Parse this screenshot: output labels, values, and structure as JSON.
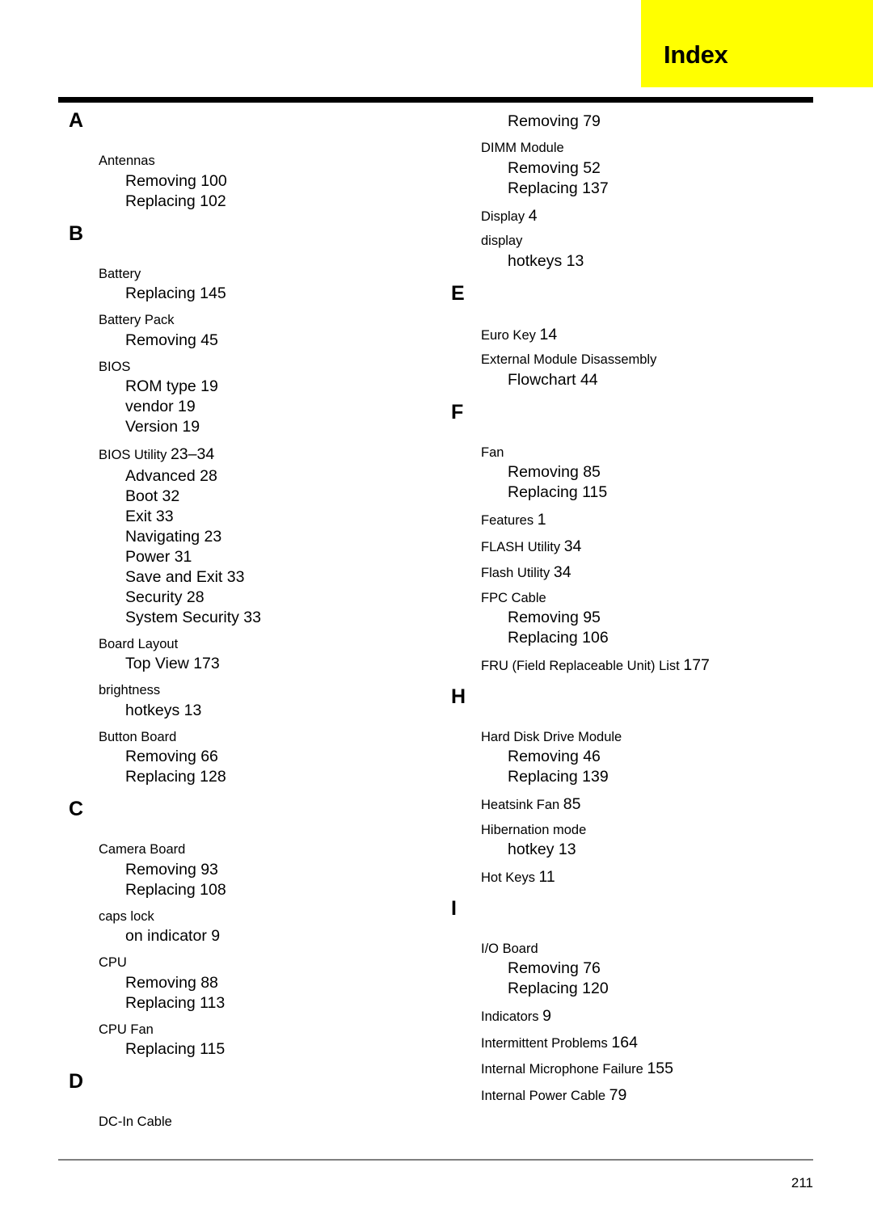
{
  "header": {
    "title": "Index"
  },
  "footer": {
    "page_number": "211"
  },
  "columns": {
    "left": [
      {
        "type": "letter",
        "text": "A"
      },
      {
        "type": "entry",
        "text": "Antennas",
        "page": ""
      },
      {
        "type": "sub",
        "text": "Removing 100"
      },
      {
        "type": "sub",
        "text": "Replacing 102"
      },
      {
        "type": "letter",
        "text": "B"
      },
      {
        "type": "entry",
        "text": "Battery",
        "page": ""
      },
      {
        "type": "sub",
        "text": "Replacing 145"
      },
      {
        "type": "entry",
        "text": "Battery Pack",
        "page": ""
      },
      {
        "type": "sub",
        "text": "Removing 45"
      },
      {
        "type": "entry",
        "text": "BIOS",
        "page": ""
      },
      {
        "type": "sub",
        "text": "ROM type 19"
      },
      {
        "type": "sub",
        "text": "vendor 19"
      },
      {
        "type": "sub",
        "text": "Version 19"
      },
      {
        "type": "entry",
        "text": "BIOS Utility ",
        "page": "23–34"
      },
      {
        "type": "sub",
        "text": "Advanced 28"
      },
      {
        "type": "sub",
        "text": "Boot 32"
      },
      {
        "type": "sub",
        "text": "Exit 33"
      },
      {
        "type": "sub",
        "text": "Navigating 23"
      },
      {
        "type": "sub",
        "text": "Power 31"
      },
      {
        "type": "sub",
        "text": "Save and Exit 33"
      },
      {
        "type": "sub",
        "text": "Security 28"
      },
      {
        "type": "sub",
        "text": "System Security 33"
      },
      {
        "type": "entry",
        "text": "Board Layout",
        "page": ""
      },
      {
        "type": "sub",
        "text": "Top View 173"
      },
      {
        "type": "entry",
        "text": "brightness",
        "page": ""
      },
      {
        "type": "sub",
        "text": "hotkeys 13"
      },
      {
        "type": "entry",
        "text": "Button Board",
        "page": ""
      },
      {
        "type": "sub",
        "text": "Removing 66"
      },
      {
        "type": "sub",
        "text": "Replacing 128"
      },
      {
        "type": "letter",
        "text": "C"
      },
      {
        "type": "entry",
        "text": "Camera Board",
        "page": ""
      },
      {
        "type": "sub",
        "text": "Removing 93"
      },
      {
        "type": "sub",
        "text": "Replacing 108"
      },
      {
        "type": "entry",
        "text": "caps lock",
        "page": ""
      },
      {
        "type": "sub",
        "text": "on indicator 9"
      },
      {
        "type": "entry",
        "text": "CPU",
        "page": ""
      },
      {
        "type": "sub",
        "text": "Removing 88"
      },
      {
        "type": "sub",
        "text": "Replacing 113"
      },
      {
        "type": "entry",
        "text": "CPU Fan",
        "page": ""
      },
      {
        "type": "sub",
        "text": "Replacing 115"
      },
      {
        "type": "letter",
        "text": "D"
      },
      {
        "type": "entry",
        "text": "DC-In Cable",
        "page": ""
      }
    ],
    "right": [
      {
        "type": "sub",
        "text": "Removing 79"
      },
      {
        "type": "entry",
        "text": "DIMM Module",
        "page": ""
      },
      {
        "type": "sub",
        "text": "Removing 52"
      },
      {
        "type": "sub",
        "text": "Replacing 137"
      },
      {
        "type": "entry",
        "text": "Display ",
        "page": "4"
      },
      {
        "type": "entry",
        "text": "display",
        "page": ""
      },
      {
        "type": "sub",
        "text": "hotkeys 13"
      },
      {
        "type": "letter",
        "text": "E"
      },
      {
        "type": "entry",
        "text": "Euro Key ",
        "page": "14"
      },
      {
        "type": "entry",
        "text": "External Module Disassembly",
        "page": ""
      },
      {
        "type": "sub",
        "text": "Flowchart 44"
      },
      {
        "type": "letter",
        "text": "F"
      },
      {
        "type": "entry",
        "text": "Fan",
        "page": ""
      },
      {
        "type": "sub",
        "text": "Removing 85"
      },
      {
        "type": "sub",
        "text": "Replacing 115"
      },
      {
        "type": "entry",
        "text": "Features ",
        "page": "1"
      },
      {
        "type": "entry",
        "text": "FLASH Utility ",
        "page": "34"
      },
      {
        "type": "entry",
        "text": "Flash Utility ",
        "page": "34"
      },
      {
        "type": "entry",
        "text": "FPC Cable",
        "page": ""
      },
      {
        "type": "sub",
        "text": "Removing 95"
      },
      {
        "type": "sub",
        "text": "Replacing 106"
      },
      {
        "type": "entry",
        "text": "FRU (Field Replaceable Unit) List ",
        "page": "177"
      },
      {
        "type": "letter",
        "text": "H"
      },
      {
        "type": "entry",
        "text": "Hard Disk Drive Module",
        "page": ""
      },
      {
        "type": "sub",
        "text": "Removing 46"
      },
      {
        "type": "sub",
        "text": "Replacing 139"
      },
      {
        "type": "entry",
        "text": "Heatsink Fan ",
        "page": "85"
      },
      {
        "type": "entry",
        "text": "Hibernation mode",
        "page": ""
      },
      {
        "type": "sub",
        "text": "hotkey 13"
      },
      {
        "type": "entry",
        "text": "Hot Keys ",
        "page": "11"
      },
      {
        "type": "letter",
        "text": "I"
      },
      {
        "type": "entry",
        "text": "I/O Board",
        "page": ""
      },
      {
        "type": "sub",
        "text": "Removing 76"
      },
      {
        "type": "sub",
        "text": "Replacing 120"
      },
      {
        "type": "entry",
        "text": "Indicators ",
        "page": "9"
      },
      {
        "type": "entry",
        "text": "Intermittent Problems ",
        "page": "164"
      },
      {
        "type": "entry",
        "text": "Internal Microphone Failure ",
        "page": "155"
      },
      {
        "type": "entry",
        "text": "Internal Power Cable ",
        "page": "79"
      }
    ]
  }
}
